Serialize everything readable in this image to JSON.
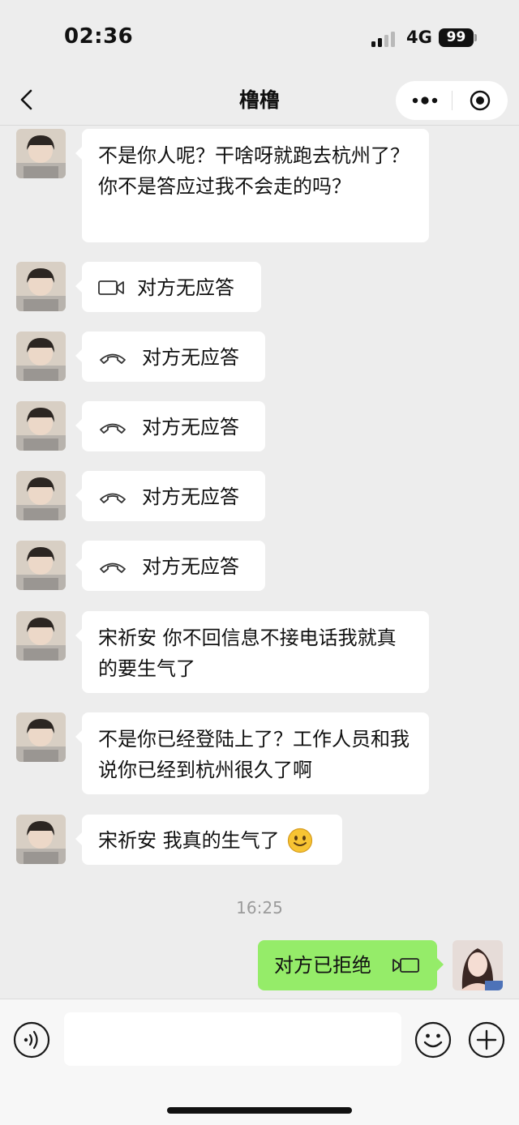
{
  "status_bar": {
    "time": "02:36",
    "network": "4G",
    "battery": "99"
  },
  "nav": {
    "title": "橹橹"
  },
  "messages": [
    {
      "type": "text",
      "text": "不是你人呢？干啥呀就跑去杭州了？你不是答应过我不会走的吗？"
    },
    {
      "type": "call",
      "icon": "video-camera-icon",
      "text": "对方无应答"
    },
    {
      "type": "call",
      "icon": "phone-icon",
      "text": "对方无应答"
    },
    {
      "type": "call",
      "icon": "phone-icon",
      "text": "对方无应答"
    },
    {
      "type": "call",
      "icon": "phone-icon",
      "text": "对方无应答"
    },
    {
      "type": "call",
      "icon": "phone-icon",
      "text": "对方无应答"
    },
    {
      "type": "text",
      "text": "宋祈安 你不回信息不接电话我就真的要生气了"
    },
    {
      "type": "text",
      "text": "不是你已经登陆上了？工作人员和我说你已经到杭州很久了啊"
    },
    {
      "type": "text",
      "text": "宋祈安 我真的生气了"
    }
  ],
  "timestamp": "16:25",
  "outgoing": {
    "text": "对方已拒绝",
    "icon": "video-camera-icon"
  },
  "input": {
    "placeholder": ""
  },
  "colors": {
    "background": "#ededed",
    "incoming_bubble": "#ffffff",
    "outgoing_bubble": "#95ec69"
  }
}
